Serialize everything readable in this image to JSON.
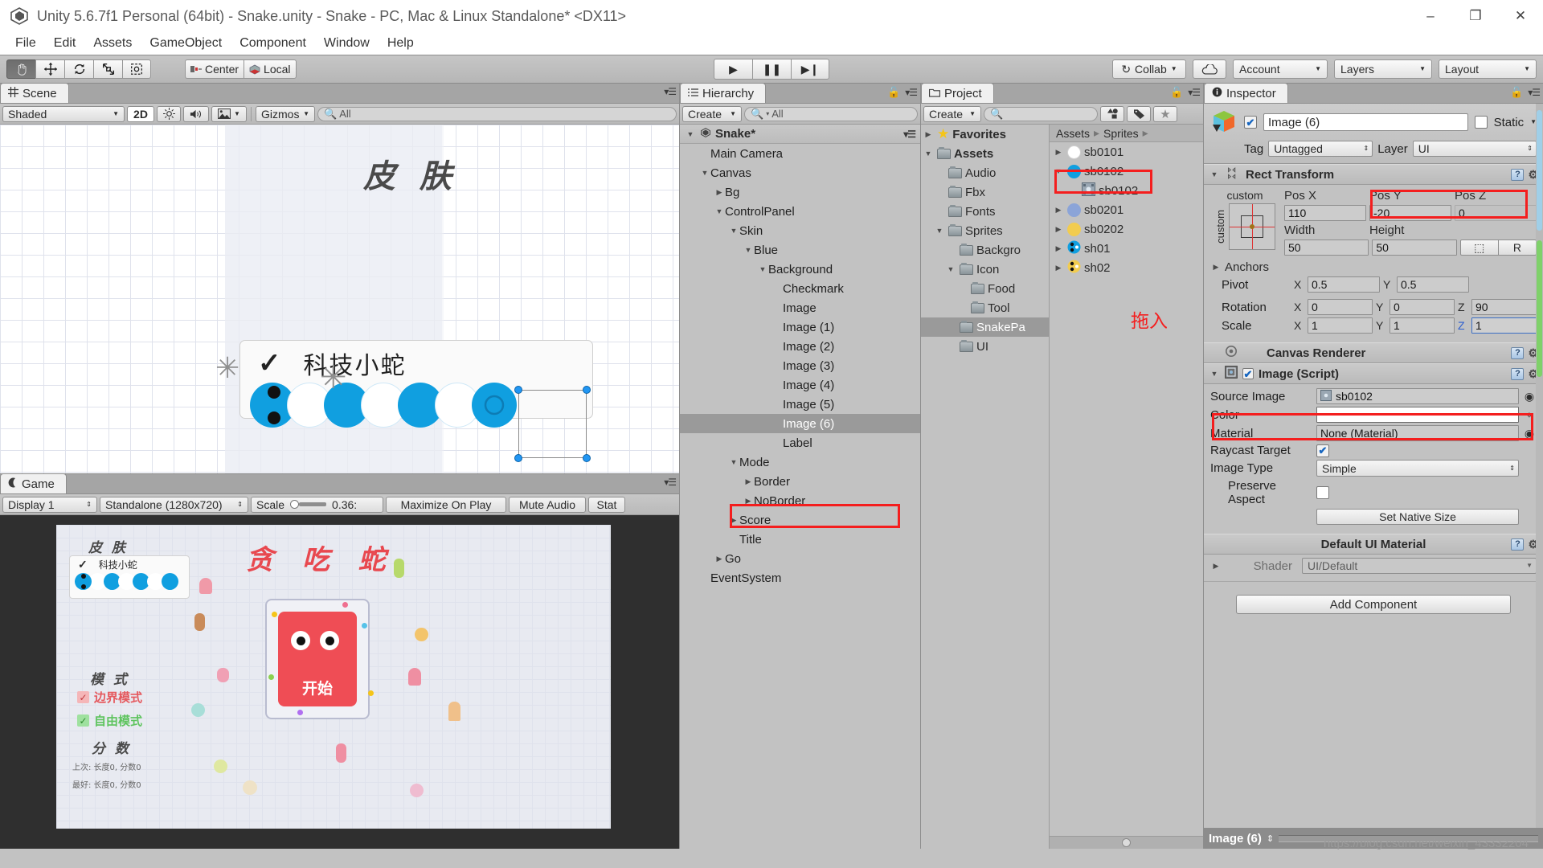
{
  "window": {
    "title": "Unity 5.6.7f1 Personal (64bit) - Snake.unity - Snake - PC, Mac & Linux Standalone* <DX11>",
    "minimize": "–",
    "maximize": "❐",
    "close": "✕"
  },
  "menubar": [
    "File",
    "Edit",
    "Assets",
    "GameObject",
    "Component",
    "Window",
    "Help"
  ],
  "toolbar": {
    "transform_tools": [
      "hand-tool",
      "move-tool",
      "rotate-tool",
      "scale-tool",
      "rect-tool"
    ],
    "pivot_mode": "Center",
    "pivot_rotation": "Local",
    "play": "▶",
    "pause": "❚❚",
    "step": "▶❙",
    "collab": "Collab",
    "cloud": "cloud-icon",
    "account": "Account",
    "layers": "Layers",
    "layout": "Layout"
  },
  "scene": {
    "tab": "Scene",
    "draw_mode": "Shaded",
    "mode_2d": "2D",
    "lighting": "lighting-icon",
    "audio": "audio-icon",
    "effects": "effects-icon",
    "gizmos": "Gizmos",
    "search_placeholder": "All",
    "title_text": "皮 肤",
    "skin_option_label": "科技小蛇",
    "checkmark": "✓"
  },
  "game": {
    "tab": "Game",
    "display": "Display 1",
    "aspect": "Standalone (1280x720)",
    "scale_label": "Scale",
    "scale_value": "0.36:",
    "maximize_on_play": "Maximize On Play",
    "mute_audio": "Mute Audio",
    "stats": "Stat",
    "title_skin": "皮 肤",
    "skin_option": "科技小蛇",
    "title_game": "贪 吃 蛇",
    "title_mode": "模 式",
    "mode_border": "边界模式",
    "mode_free": "自由模式",
    "title_score": "分 数",
    "score_line1": "上次: 长度0, 分数0",
    "score_line2": "最好: 长度0, 分数0",
    "start_button": "开始"
  },
  "hierarchy": {
    "tab": "Hierarchy",
    "create": "Create",
    "search_placeholder": "All",
    "scene_name": "Snake*",
    "items": [
      {
        "label": "Main Camera",
        "depth": 1,
        "arrow": ""
      },
      {
        "label": "Canvas",
        "depth": 1,
        "arrow": "open"
      },
      {
        "label": "Bg",
        "depth": 2,
        "arrow": "closed"
      },
      {
        "label": "ControlPanel",
        "depth": 2,
        "arrow": "open"
      },
      {
        "label": "Skin",
        "depth": 3,
        "arrow": "open"
      },
      {
        "label": "Blue",
        "depth": 4,
        "arrow": "open"
      },
      {
        "label": "Background",
        "depth": 5,
        "arrow": "open"
      },
      {
        "label": "Checkmark",
        "depth": 6,
        "arrow": ""
      },
      {
        "label": "Image",
        "depth": 6,
        "arrow": ""
      },
      {
        "label": "Image (1)",
        "depth": 6,
        "arrow": ""
      },
      {
        "label": "Image (2)",
        "depth": 6,
        "arrow": ""
      },
      {
        "label": "Image (3)",
        "depth": 6,
        "arrow": ""
      },
      {
        "label": "Image (4)",
        "depth": 6,
        "arrow": ""
      },
      {
        "label": "Image (5)",
        "depth": 6,
        "arrow": ""
      },
      {
        "label": "Image (6)",
        "depth": 6,
        "arrow": "",
        "selected": true
      },
      {
        "label": "Label",
        "depth": 6,
        "arrow": ""
      },
      {
        "label": "Mode",
        "depth": 3,
        "arrow": "open"
      },
      {
        "label": "Border",
        "depth": 4,
        "arrow": "closed"
      },
      {
        "label": "NoBorder",
        "depth": 4,
        "arrow": "closed"
      },
      {
        "label": "Score",
        "depth": 3,
        "arrow": "closed"
      },
      {
        "label": "Title",
        "depth": 3,
        "arrow": ""
      },
      {
        "label": "Go",
        "depth": 2,
        "arrow": "closed"
      },
      {
        "label": "EventSystem",
        "depth": 1,
        "arrow": ""
      }
    ]
  },
  "project": {
    "tab": "Project",
    "create": "Create",
    "search_placeholder": "",
    "icons": [
      "filter-type-icon",
      "filter-label-icon",
      "favorite-star-icon"
    ],
    "breadcrumb": [
      "Assets",
      "Sprites"
    ],
    "tree": [
      {
        "label": "Favorites",
        "depth": 0,
        "arrow": "closed",
        "icon": "star",
        "bold": true
      },
      {
        "label": "Assets",
        "depth": 0,
        "arrow": "open",
        "icon": "folder",
        "bold": true
      },
      {
        "label": "Audio",
        "depth": 1,
        "arrow": "",
        "icon": "folder"
      },
      {
        "label": "Fbx",
        "depth": 1,
        "arrow": "",
        "icon": "folder"
      },
      {
        "label": "Fonts",
        "depth": 1,
        "arrow": "",
        "icon": "folder"
      },
      {
        "label": "Sprites",
        "depth": 1,
        "arrow": "open",
        "icon": "folder"
      },
      {
        "label": "Backgro",
        "depth": 2,
        "arrow": "",
        "icon": "folder"
      },
      {
        "label": "Icon",
        "depth": 2,
        "arrow": "open",
        "icon": "folder"
      },
      {
        "label": "Food",
        "depth": 3,
        "arrow": "",
        "icon": "folder"
      },
      {
        "label": "Tool",
        "depth": 3,
        "arrow": "",
        "icon": "folder"
      },
      {
        "label": "SnakePa",
        "depth": 2,
        "arrow": "",
        "icon": "folder",
        "selected": true
      },
      {
        "label": "UI",
        "depth": 2,
        "arrow": "",
        "icon": "folder"
      }
    ],
    "assets": [
      {
        "label": "sb0101",
        "arrow": "closed",
        "color": "#ffffff",
        "kind": "sprite"
      },
      {
        "label": "sb0102",
        "arrow": "open",
        "color": "#109fe0",
        "kind": "sprite",
        "highlighted": true
      },
      {
        "label": "sb0102",
        "arrow": "",
        "kind": "subsprite",
        "child": true
      },
      {
        "label": "sb0201",
        "arrow": "closed",
        "color": "#8ba4d8",
        "kind": "sprite"
      },
      {
        "label": "sb0202",
        "arrow": "closed",
        "color": "#f2cc4f",
        "kind": "sprite"
      },
      {
        "label": "sh01",
        "arrow": "closed",
        "color": "#109fe0",
        "kind": "head"
      },
      {
        "label": "sh02",
        "arrow": "closed",
        "color": "#f2cc4f",
        "kind": "head"
      }
    ]
  },
  "inspector": {
    "tab": "Inspector",
    "object_name": "Image (6)",
    "enabled": true,
    "static_label": "Static",
    "tag_label": "Tag",
    "tag_value": "Untagged",
    "layer_label": "Layer",
    "layer_value": "UI",
    "rect_transform": {
      "title": "Rect Transform",
      "anchor_preset": "custom",
      "anchor_side": "custom",
      "pos_x_label": "Pos X",
      "pos_y_label": "Pos Y",
      "pos_z_label": "Pos Z",
      "pos_x": "110",
      "pos_y": "-20",
      "pos_z": "0",
      "width_label": "Width",
      "height_label": "Height",
      "width": "50",
      "height": "50",
      "blueprint_button": "⬚",
      "raw_button": "R",
      "anchors_label": "Anchors",
      "pivot_label": "Pivot",
      "pivot_x": "0.5",
      "pivot_y": "0.5",
      "rotation_label": "Rotation",
      "rot_x": "0",
      "rot_y": "0",
      "rot_z": "90",
      "scale_label": "Scale",
      "scale_x": "1",
      "scale_y": "1",
      "scale_z": "1"
    },
    "canvas_renderer": {
      "title": "Canvas Renderer"
    },
    "image_script": {
      "title": "Image (Script)",
      "enabled": true,
      "source_image_label": "Source Image",
      "source_image_value": "sb0102",
      "color_label": "Color",
      "color_value": "#ffffff",
      "material_label": "Material",
      "material_value": "None (Material)",
      "raycast_label": "Raycast Target",
      "raycast_checked": true,
      "image_type_label": "Image Type",
      "image_type_value": "Simple",
      "preserve_aspect_label": "Preserve Aspect",
      "preserve_aspect_checked": false,
      "set_native_size": "Set Native Size"
    },
    "material": {
      "title": "Default UI Material",
      "shader_label": "Shader",
      "shader_value": "UI/Default"
    },
    "add_component": "Add Component",
    "footer_name": "Image (6)"
  },
  "annotation": {
    "drag_note": "拖入",
    "accent_color": "#f41e1e"
  },
  "watermark": "https://blog.csdn.net/weixin_43332204"
}
